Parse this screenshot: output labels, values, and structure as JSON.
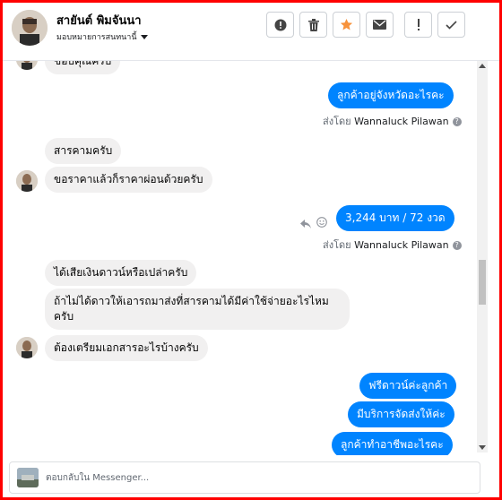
{
  "header": {
    "name": "สายันต์ พิมจันนา",
    "assign_label": "มอบหมายการสนทนานี้",
    "tools": [
      {
        "icon": "alert-circle-icon",
        "glyph": "!"
      },
      {
        "icon": "trash-icon"
      },
      {
        "icon": "star-icon",
        "color": "#f7923b"
      },
      {
        "icon": "envelope-icon"
      },
      {
        "icon": "exclamation-icon",
        "glyph": "!"
      },
      {
        "icon": "checkmark-icon"
      }
    ]
  },
  "messages": [
    {
      "dir": "in",
      "text": "ขอบคุณครับ"
    },
    {
      "dir": "out",
      "text": "ลูกค้าอยู่จังหวัดอะไรคะ",
      "sent_by_prefix": "ส่งโดย",
      "sent_by_name": "Wannaluck Pilawan"
    },
    {
      "dir": "in",
      "text": "สารคามครับ"
    },
    {
      "dir": "in",
      "text": "ขอราคาแล้วก็ราคาผ่อนด้วยครับ"
    },
    {
      "dir": "out",
      "text": "3,244 บาท  / 72 งวด",
      "sent_by_prefix": "ส่งโดย",
      "sent_by_name": "Wannaluck Pilawan"
    },
    {
      "dir": "in",
      "text": "ได้เสียเงินดาวน์หรือเปล่าครับ"
    },
    {
      "dir": "in",
      "text_line1": "ถ้าไม่ได้ดาวให้เอารถมาส่งที่สารคามได้มีค่าใช้จ่ายอะไรไหม",
      "text_line2": "ครับ"
    },
    {
      "dir": "in",
      "text": "ต้องเตรียมเอกสารอะไรบ้างครับ"
    },
    {
      "dir": "out",
      "text": "ฟรีดาวน์ค่ะลูกค้า"
    },
    {
      "dir": "out",
      "text": "มีบริการจัดส่งให้ค่ะ"
    },
    {
      "dir": "out",
      "text": "ลูกค้าทำอาชีพอะไรคะ"
    }
  ],
  "composer": {
    "placeholder": "ตอบกลับใน Messenger..."
  },
  "colors": {
    "outgoing_bubble": "#0084ff",
    "incoming_bubble": "#f1f0f0",
    "frame_border": "#ff0000"
  }
}
